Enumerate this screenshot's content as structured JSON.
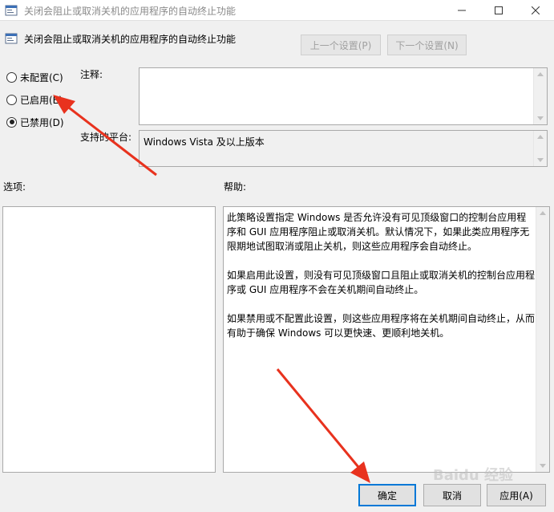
{
  "window": {
    "title": "关闭会阻止或取消关机的应用程序的自动终止功能"
  },
  "header": {
    "title": "关闭会阻止或取消关机的应用程序的自动终止功能"
  },
  "nav": {
    "prev_label": "上一个设置(P)",
    "next_label": "下一个设置(N)"
  },
  "radios": [
    {
      "label": "未配置(C)",
      "checked": false
    },
    {
      "label": "已启用(E)",
      "checked": false
    },
    {
      "label": "已禁用(D)",
      "checked": true
    }
  ],
  "comment": {
    "label": "注释:",
    "value": ""
  },
  "platform": {
    "label": "支持的平台:",
    "value": "Windows Vista 及以上版本"
  },
  "options": {
    "label": "选项:"
  },
  "help": {
    "label": "帮助:",
    "paragraphs": [
      "此策略设置指定 Windows 是否允许没有可见顶级窗口的控制台应用程序和 GUI 应用程序阻止或取消关机。默认情况下，如果此类应用程序无限期地试图取消或阻止关机，则这些应用程序会自动终止。",
      "如果启用此设置，则没有可见顶级窗口且阻止或取消关机的控制台应用程序或 GUI 应用程序不会在关机期间自动终止。",
      "如果禁用或不配置此设置，则这些应用程序将在关机期间自动终止，从而有助于确保 Windows 可以更快速、更顺利地关机。"
    ]
  },
  "buttons": {
    "ok": "确定",
    "cancel": "取消",
    "apply": "应用(A)"
  },
  "watermark": "Baidu 经验",
  "colors": {
    "annotation_arrow": "#e8321e",
    "focus_border": "#0078d7"
  }
}
